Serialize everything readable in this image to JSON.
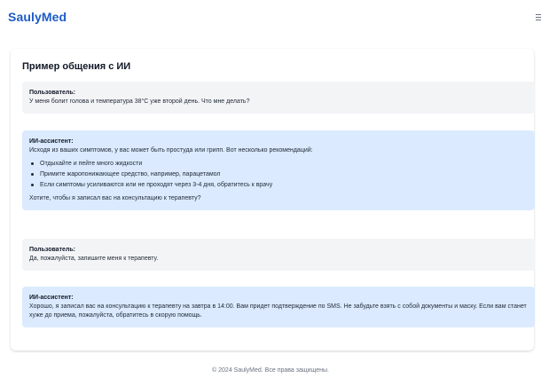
{
  "header": {
    "logo": "SaulyMed",
    "menu_icon": "menu-icon"
  },
  "chat": {
    "title": "Пример общения с ИИ",
    "messages": [
      {
        "role": "Пользователь:",
        "text": "У меня болит голова и температура 38°C уже второй день. Что мне делать?"
      },
      {
        "role": "ИИ-ассистент:",
        "intro": "Исходя из ваших симптомов, у вас может быть простуда или грипп. Вот несколько рекомендаций:",
        "items": [
          "Отдыхайте и пейте много жидкости",
          "Примите жаропонижающее средство, например, парацетамол",
          "Если симптомы усиливаются или не проходят через 3-4 дня, обратитесь к врачу"
        ],
        "outro": "Хотите, чтобы я записал вас на консультацию к терапевту?"
      },
      {
        "role": "Пользователь:",
        "text": "Да, пожалуйста, запишите меня к терапевту."
      },
      {
        "role": "ИИ-ассистент:",
        "text": "Хорошо, я записал вас на консультацию к терапевту на завтра в 14:00. Вам придет подтверждение по SMS. Не забудьте взять с собой документы и маску. Если вам станет хуже до приема, пожалуйста, обратитесь в скорую помощь."
      }
    ]
  },
  "footer": {
    "copyright": "© 2024 SaulyMed. Все права защищены."
  },
  "colors": {
    "brand": "#1e5bc6",
    "user_bubble": "#f3f4f6",
    "ai_bubble": "#dbeafe"
  }
}
